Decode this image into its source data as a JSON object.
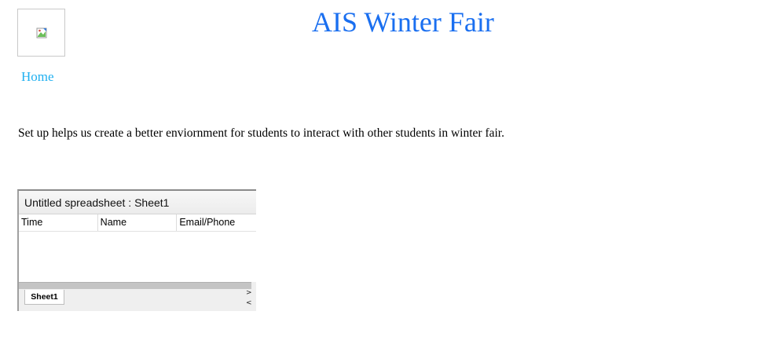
{
  "header": {
    "site_title": "AIS Winter Fair",
    "logo_alt": "",
    "logo_icon": "broken-image-icon"
  },
  "nav": {
    "home_label": "Home"
  },
  "main": {
    "description": "Set up helps us create a better enviornment for students to interact with other students in winter fair."
  },
  "spreadsheet": {
    "title": "Untitled spreadsheet : Sheet1",
    "columns": [
      "Time",
      "Name",
      "Email/Phone"
    ],
    "rows": [],
    "active_tab": "Sheet1",
    "next_arrow": ">",
    "prev_arrow": "<"
  },
  "colors": {
    "title_blue": "#1a6ff0",
    "link_cyan": "#20b0f0"
  }
}
